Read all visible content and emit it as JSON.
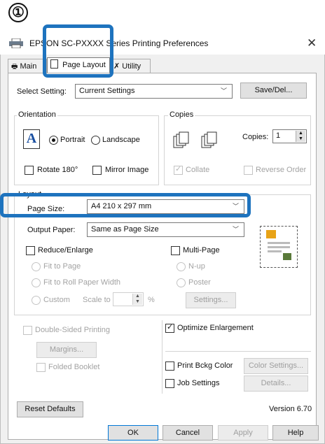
{
  "step_number": "①",
  "window": {
    "title": "EPSON SC-PXXXX Series Printing Preferences"
  },
  "tabs": [
    {
      "label": "Main"
    },
    {
      "label": "Page Layout"
    },
    {
      "label": "Utility"
    }
  ],
  "select_setting": {
    "label": "Select Setting:",
    "value": "Current Settings",
    "save_button": "Save/Del..."
  },
  "orientation": {
    "group_label": "Orientation",
    "portrait": "Portrait",
    "landscape": "Landscape",
    "selected": "Portrait",
    "rotate180": "Rotate 180°",
    "mirror_image": "Mirror Image"
  },
  "copies": {
    "group_label": "Copies",
    "copies_label": "Copies:",
    "copies_value": "1",
    "collate": "Collate",
    "reverse_order": "Reverse Order"
  },
  "layout": {
    "group_label": "Layout",
    "page_size_label": "Page Size:",
    "page_size_value": "A4 210 x 297 mm",
    "output_paper_label": "Output Paper:",
    "output_paper_value": "Same as Page Size",
    "reduce_enlarge": "Reduce/Enlarge",
    "fit_to_page": "Fit to Page",
    "fit_to_roll": "Fit to Roll Paper Width",
    "custom": "Custom",
    "scale_to": "Scale to",
    "percent": "%",
    "multi_page": "Multi-Page",
    "n_up": "N-up",
    "poster": "Poster",
    "settings_button": "Settings..."
  },
  "double_sided": {
    "label": "Double-Sided Printing",
    "margins_button": "Margins...",
    "folded_booklet": "Folded Booklet"
  },
  "optimize_enlargement": "Optimize Enlargement",
  "print_bckg_color": "Print Bckg Color",
  "color_settings_button": "Color Settings...",
  "job_settings": "Job Settings",
  "details_button": "Details...",
  "reset_defaults_button": "Reset Defaults",
  "version": "Version 6.70",
  "footer": {
    "ok": "OK",
    "cancel": "Cancel",
    "apply": "Apply",
    "help": "Help"
  },
  "colors": {
    "highlight": "#1e73be",
    "printer_accent": "#e8a317"
  }
}
